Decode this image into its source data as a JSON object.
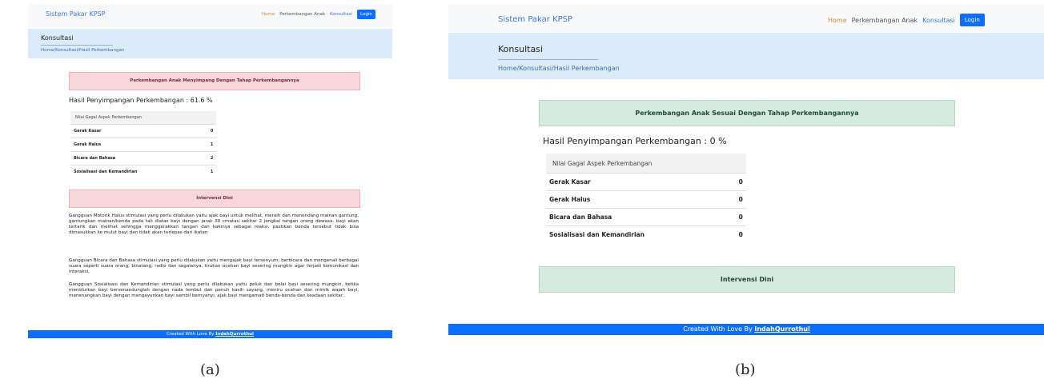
{
  "panel_a": {
    "caption": "(a)",
    "brand": "Sistem Pakar KPSP",
    "nav": [
      "Home",
      "Perkembangan Anak",
      "Konsultasi"
    ],
    "login": "Login",
    "crumb_title": "Konsultasi",
    "crumb_path": "Home/Konsultasi/Hasil Perkembangan",
    "alert": "Perkembangan Anak Menyimpang Dengan Tahap Perkembangannya",
    "result": "Hasil Penyimpangan Perkembangan : 61.6 %",
    "table_header": "Nilai Gagal Aspek Perkembangan",
    "rows": [
      {
        "label": "Gerak Kasar",
        "value": "0"
      },
      {
        "label": "Gerak Halus",
        "value": "1"
      },
      {
        "label": "Bicara dan Bahasa",
        "value": "2"
      },
      {
        "label": "Sosialisasi dan Kemandirian",
        "value": "1"
      }
    ],
    "intervensi_title": "Intervensi Dini",
    "paragraphs": [
      "Gangguan Motorik Halus stimulasi yang perlu dilakukan yaitu ajak bayi untuk melihat, meraih dan menendang mainan gantung, gantungkan mainan/benda pada tali diatas bayi dengan jarak 30 cmatau sekitar 2 jengkal tangan orang dewasa, bayi akan tertarik dan melihat sehingga menggerakkan tangan dan kakinya sebagai reaksi, pastikan benda tersebut tidak bisa dimasukkan ke mulut bayi dan tidak akan terlepas dari ikatan",
      "Gangguan Bicara dan Bahasa stimulasi yang perlu dilakukan yaitu mengajak bayi tersenyum, berbicara dan mengenali berbagai suara seperti suara orang, binatang, radio dan segalanya, tirukan ocehan bayi sesering mungkin agar terjadi komunikasi dan interaksi.",
      "Gangguan Sosialisasi dan Kemandirian stimulasi yang perlu dilakukan yaitu peluk dan belai bayi sesering mungkin, ketika menidurkan bayi bersenandunglah dengan nada lembut dan penuh kasih sayang, meniru ocehan dan mimik wajah bayi, menenangkan bayi dengan mengayunkan bayi sambil bernyanyi, ajak bayi mengamati benda-benda dan keadaan sekitar."
    ],
    "footer_text": "Created With Love By ",
    "footer_link": "IndahQurrothul"
  },
  "panel_b": {
    "caption": "(b)",
    "brand": "Sistem Pakar KPSP",
    "nav": [
      "Home",
      "Perkembangan Anak",
      "Konsultasi"
    ],
    "login": "Login",
    "crumb_title": "Konsultasi",
    "crumb_path": "Home/Konsultasi/Hasil Perkembangan",
    "alert": "Perkembangan Anak Sesuai Dengan Tahap Perkembangannya",
    "result": "Hasil Penyimpangan Perkembangan : 0 %",
    "table_header": "Nilai Gagal Aspek Perkembangan",
    "rows": [
      {
        "label": "Gerak Kasar",
        "value": "0"
      },
      {
        "label": "Gerak Halus",
        "value": "0"
      },
      {
        "label": "Bicara dan Bahasa",
        "value": "0"
      },
      {
        "label": "Sosialisasi dan Kemandirian",
        "value": "0"
      }
    ],
    "intervensi_title": "Intervensi Dini",
    "footer_text": "Created With Love By ",
    "footer_link": "IndahQurrothul"
  }
}
